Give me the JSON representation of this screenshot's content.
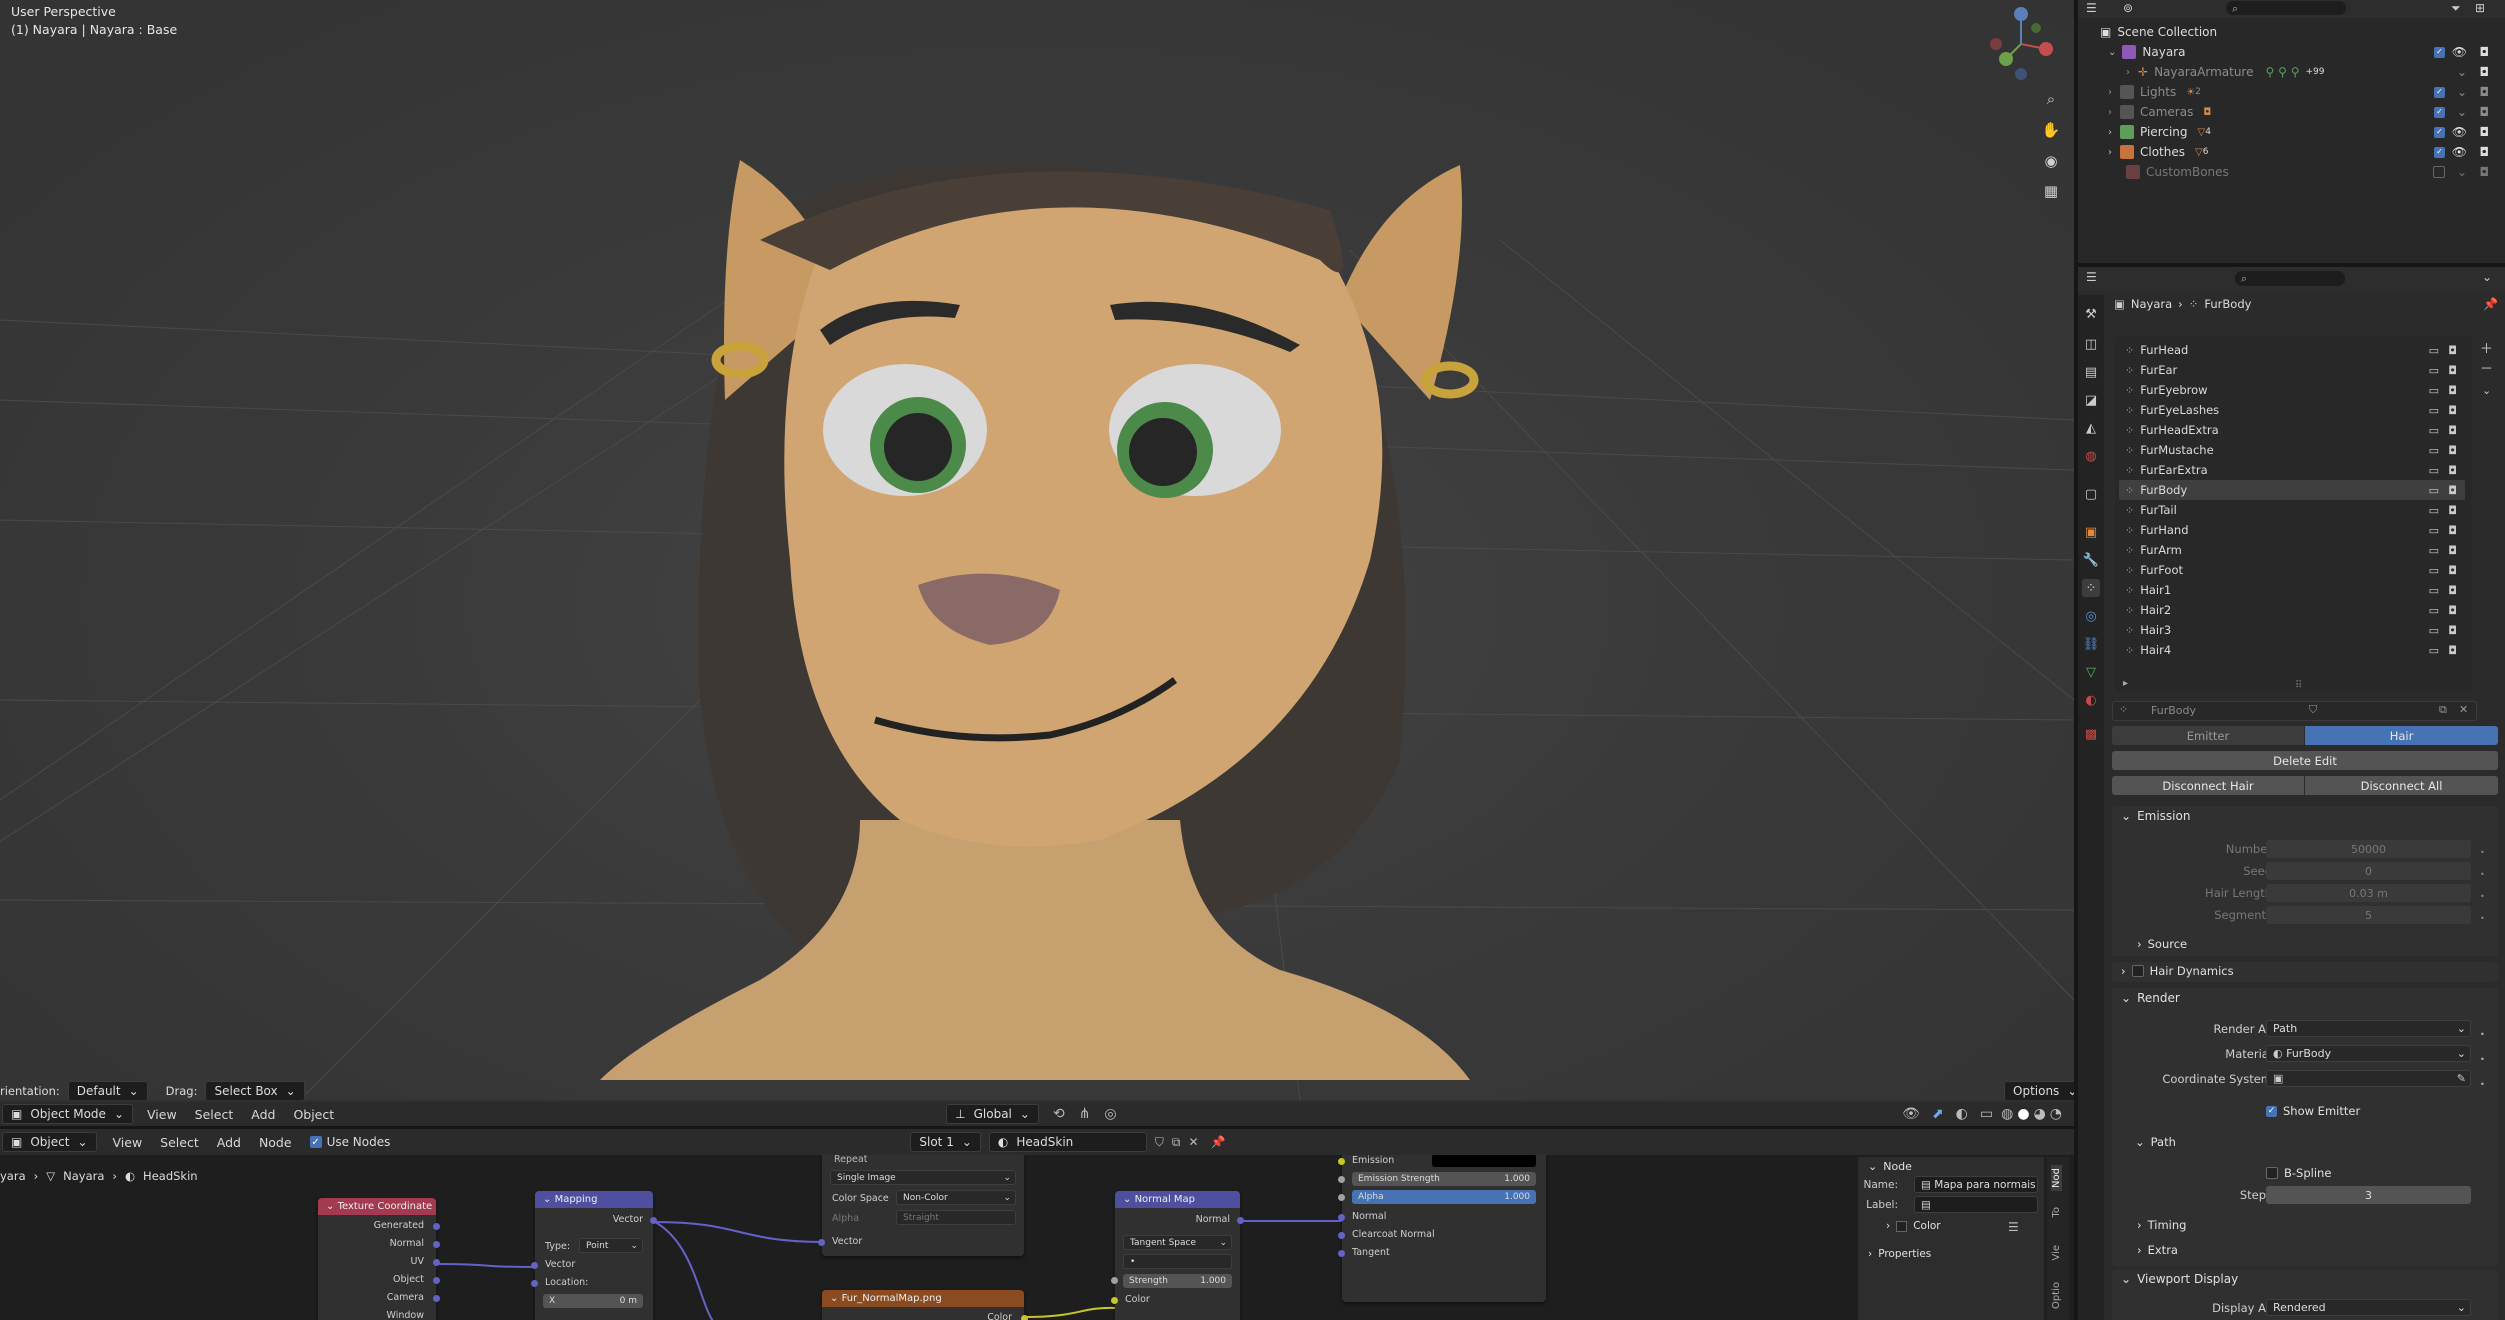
{
  "viewport": {
    "perspective": "User Perspective",
    "object_info": "(1) Nayara | Nayara : Base",
    "footer": {
      "orientation_label": "rientation:",
      "orientation_value": "Default",
      "drag_label": "Drag:",
      "drag_value": "Select Box",
      "options": "Options"
    },
    "header": {
      "mode": "Object Mode",
      "menus": [
        "View",
        "Select",
        "Add",
        "Object"
      ],
      "transform": "Global"
    }
  },
  "node_editor": {
    "header": {
      "type": "Object",
      "menus": [
        "View",
        "Select",
        "Add",
        "Node"
      ],
      "use_nodes": "Use Nodes",
      "slot": "Slot 1",
      "material": "HeadSkin"
    },
    "breadcrumb": [
      "yara",
      "Nayara",
      "HeadSkin"
    ],
    "nodes": {
      "texcoord": {
        "title": "Texture Coordinate",
        "outputs": [
          "Generated",
          "Normal",
          "UV",
          "Object",
          "Camera",
          "Window"
        ]
      },
      "mapping": {
        "title": "Mapping",
        "output": "Vector",
        "type_label": "Type:",
        "type_value": "Point",
        "input_vector": "Vector",
        "location": "Location:",
        "x_label": "X",
        "x_value": "0 m"
      },
      "image": {
        "repeat": "Repeat",
        "source": "Single Image",
        "cs_label": "Color Space",
        "cs_value": "Non-Color",
        "alpha_label": "Alpha",
        "alpha_value": "Straight",
        "input_vector": "Vector"
      },
      "image2": {
        "title": "Fur_NormalMap.png",
        "output": "Color"
      },
      "normalmap": {
        "title": "Normal Map",
        "output": "Normal",
        "space": "Tangent Space",
        "uv": "•",
        "strength_label": "Strength",
        "strength_value": "1.000",
        "input_color": "Color"
      },
      "bsdf": {
        "emission": "Emission",
        "emission_strength_label": "Emission Strength",
        "emission_strength_value": "1.000",
        "alpha_label": "Alpha",
        "alpha_value": "1.000",
        "normal": "Normal",
        "clearcoat_normal": "Clearcoat Normal",
        "tangent": "Tangent"
      }
    },
    "sidebar": {
      "section": "Node",
      "name_label": "Name:",
      "name_value": "Mapa para normais",
      "label_label": "Label:",
      "color": "Color",
      "properties": "Properties",
      "tabs": [
        "Nod",
        "To",
        "Vie",
        "Optio"
      ]
    }
  },
  "outliner": {
    "title": "Scene Collection",
    "rows": [
      {
        "label": "Nayara",
        "badge": ""
      },
      {
        "label": "NayaraArmature",
        "badge": "+99"
      },
      {
        "label": "Lights",
        "badge": "2"
      },
      {
        "label": "Cameras",
        "badge": ""
      },
      {
        "label": "Piercing",
        "badge": "4"
      },
      {
        "label": "Clothes",
        "badge": "6"
      },
      {
        "label": "CustomBones",
        "badge": ""
      }
    ]
  },
  "properties": {
    "breadcrumb": [
      "Nayara",
      "FurBody"
    ],
    "systems": [
      "FurHead",
      "FurEar",
      "FurEyebrow",
      "FurEyeLashes",
      "FurHeadExtra",
      "FurMustache",
      "FurEarExtra",
      "FurBody",
      "FurTail",
      "FurHand",
      "FurArm",
      "FurFoot",
      "Hair1",
      "Hair2",
      "Hair3",
      "Hair4"
    ],
    "selected_system": "FurBody",
    "settings_name": "FurBody",
    "type_tabs": [
      "Emitter",
      "Hair"
    ],
    "delete_edit": "Delete Edit",
    "disconnect_hair": "Disconnect Hair",
    "disconnect_all": "Disconnect All",
    "emission": {
      "title": "Emission",
      "number_label": "Number",
      "number_value": "50000",
      "seed_label": "Seed",
      "seed_value": "0",
      "hair_length_label": "Hair Length",
      "hair_length_value": "0.03 m",
      "segments_label": "Segments",
      "segments_value": "5"
    },
    "source": "Source",
    "hair_dynamics": "Hair Dynamics",
    "render": {
      "title": "Render",
      "render_as_label": "Render As",
      "render_as_value": "Path",
      "material_label": "Material",
      "material_value": "FurBody",
      "coord_label": "Coordinate System",
      "show_emitter": "Show Emitter"
    },
    "path": {
      "title": "Path",
      "bspline": "B-Spline",
      "steps_label": "Steps",
      "steps_value": "3"
    },
    "timing": "Timing",
    "extra": "Extra",
    "viewport_display": {
      "title": "Viewport Display",
      "display_as_label": "Display As",
      "display_as_value": "Rendered"
    }
  }
}
